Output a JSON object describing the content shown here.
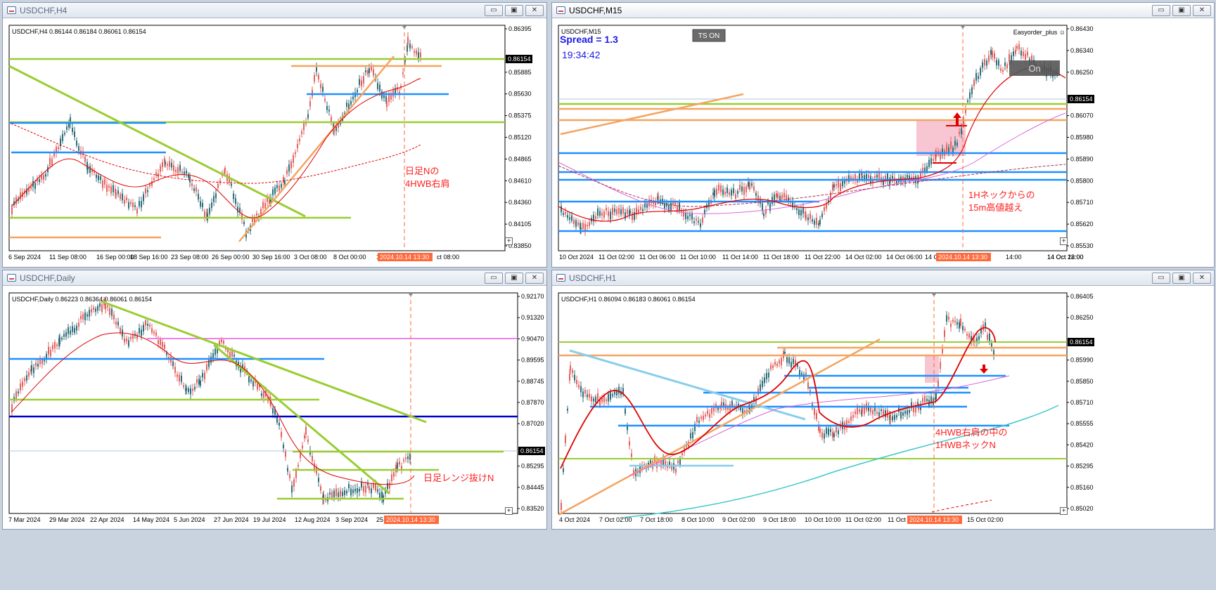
{
  "windows": [
    {
      "id": "h4",
      "title": "USDCHF,H4",
      "active": false,
      "symbol_line": "USDCHF,H4  0.86144 0.86184 0.86061 0.86154",
      "price_labels": [
        "0.86395",
        "0.86154",
        "0.85885",
        "0.85630",
        "0.85375",
        "0.85120",
        "0.84865",
        "0.84610",
        "0.84360",
        "0.84105",
        "0.83850"
      ],
      "current_price": "0.86154",
      "time_labels": [
        "6 Sep 2024",
        "11 Sep 08:00",
        "16 Sep 00:00",
        "18 Sep 16:00",
        "23 Sep 08:00",
        "26 Sep 00:00",
        "30 Sep 16:00",
        "3 Oct 08:00",
        "8 Oct 00:00",
        "1",
        "ct 08:00"
      ],
      "vline_label": "2024.10.14 13:30",
      "annotations": [
        "日足Nの",
        "4HWB右肩"
      ]
    },
    {
      "id": "m15",
      "title": "USDCHF,M15",
      "active": true,
      "symbol_line": "USDCHF,M15",
      "spread": "Spread = 1.3",
      "clock": "19:34:42",
      "ts_button": "TS ON",
      "ea_name": "Easyorder_plus ☺",
      "on_button": "On",
      "price_labels": [
        "0.86430",
        "0.86340",
        "0.86250",
        "0.86154",
        "0.86070",
        "0.85980",
        "0.85890",
        "0.85800",
        "0.85710",
        "0.85620",
        "0.85530"
      ],
      "current_price": "0.86154",
      "time_labels": [
        "10 Oct 2024",
        "11 Oct 02:00",
        "11 Oct 06:00",
        "11 Oct 10:00",
        "11 Oct 14:00",
        "11 Oct 18:00",
        "11 Oct 22:00",
        "14 Oct 02:00",
        "14 Oct 06:00",
        "14 C",
        "14:00",
        "14 Oct 18:00",
        "14 Oct 22:00"
      ],
      "vline_label": "2024.10.14 13:30",
      "annotations": [
        "1Hネックからの",
        "15m高値越え"
      ]
    },
    {
      "id": "d1",
      "title": "USDCHF,Daily",
      "active": false,
      "symbol_line": "USDCHF,Daily  0.86223 0.86364 0.86061 0.86154",
      "price_labels": [
        "0.92170",
        "0.91320",
        "0.90470",
        "0.89595",
        "0.88745",
        "0.87870",
        "0.87020",
        "0.86154",
        "0.85295",
        "0.84445",
        "0.83520"
      ],
      "current_price": "0.86154",
      "time_labels": [
        "7 Mar 2024",
        "29 Mar 2024",
        "22 Apr 2024",
        "14 May 2024",
        "5 Jun 2024",
        "27 Jun 2024",
        "19 Jul 2024",
        "12 Aug 2024",
        "3 Sep 2024",
        "25"
      ],
      "vline_label": "2024.10.14 13:30",
      "annotations": [
        "日足レンジ抜けN"
      ]
    },
    {
      "id": "h1",
      "title": "USDCHF,H1",
      "active": false,
      "symbol_line": "USDCHF,H1  0.86094 0.86183 0.86061 0.86154",
      "price_labels": [
        "0.86405",
        "0.86250",
        "0.86154",
        "0.85990",
        "0.85850",
        "0.85710",
        "0.85555",
        "0.85420",
        "0.85295",
        "0.85160",
        "0.85020"
      ],
      "current_price": "0.86154",
      "time_labels": [
        "4 Oct 2024",
        "7 Oct 02:00",
        "7 Oct 18:00",
        "8 Oct 10:00",
        "9 Oct 02:00",
        "9 Oct 18:00",
        "10 Oct 10:00",
        "11 Oct 02:00",
        "11 Oct 1",
        "15 Oct 02:00"
      ],
      "vline_label": "2024.10.14 13:30",
      "annotations": [
        "4HWB右肩の中の",
        "1HWBネックN"
      ]
    }
  ],
  "window_buttons": [
    "▭",
    "▣",
    "✕"
  ],
  "colors": {
    "bull": "#2f6e7a",
    "bear": "#e3625f",
    "green_line": "#9acd32",
    "orange_line": "#f4a460",
    "blue_line": "#1e90ff",
    "navy_line": "#0000cd",
    "ma_red": "#e00000",
    "magenta": "#d966d9",
    "aqua": "#40c8c8",
    "vline": "#ff6a3c",
    "annotation": "#ff2020"
  }
}
